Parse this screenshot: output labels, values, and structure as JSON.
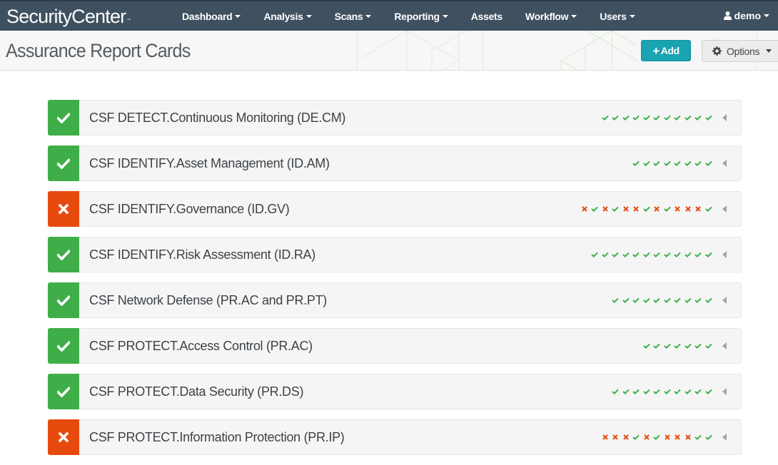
{
  "app": {
    "brand": "SecurityCenter",
    "brand_mark": "™"
  },
  "nav": {
    "items": [
      {
        "label": "Dashboard",
        "dropdown": true
      },
      {
        "label": "Analysis",
        "dropdown": true
      },
      {
        "label": "Scans",
        "dropdown": true
      },
      {
        "label": "Reporting",
        "dropdown": true
      },
      {
        "label": "Assets",
        "dropdown": false
      },
      {
        "label": "Workflow",
        "dropdown": true
      },
      {
        "label": "Users",
        "dropdown": true
      }
    ],
    "user": {
      "label": "demo",
      "icon": "user-icon"
    }
  },
  "page": {
    "title": "Assurance Report Cards",
    "add_button": {
      "label": "Add",
      "icon": "plus-icon"
    },
    "options_button": {
      "label": "Options",
      "icon": "gear-icon"
    }
  },
  "colors": {
    "nav_bg": "#3f5060",
    "pass": "#3fae49",
    "fail": "#e64a0c",
    "add_button": "#1aa3b0"
  },
  "cards": [
    {
      "title": "CSF DETECT.Continuous Monitoring (DE.CM)",
      "status": "pass",
      "history": [
        "pass",
        "pass",
        "pass",
        "pass",
        "pass",
        "pass",
        "pass",
        "pass",
        "pass",
        "pass",
        "pass"
      ]
    },
    {
      "title": "CSF IDENTIFY.Asset Management (ID.AM)",
      "status": "pass",
      "history": [
        "pass",
        "pass",
        "pass",
        "pass",
        "pass",
        "pass",
        "pass",
        "pass"
      ]
    },
    {
      "title": "CSF IDENTIFY.Governance (ID.GV)",
      "status": "fail",
      "history": [
        "fail",
        "pass",
        "fail",
        "pass",
        "fail",
        "fail",
        "pass",
        "fail",
        "pass",
        "fail",
        "fail",
        "fail",
        "pass"
      ]
    },
    {
      "title": "CSF IDENTIFY.Risk Assessment (ID.RA)",
      "status": "pass",
      "history": [
        "pass",
        "pass",
        "pass",
        "pass",
        "pass",
        "pass",
        "pass",
        "pass",
        "pass",
        "pass",
        "pass",
        "pass"
      ]
    },
    {
      "title": "CSF Network Defense (PR.AC and PR.PT)",
      "status": "pass",
      "history": [
        "pass",
        "pass",
        "pass",
        "pass",
        "pass",
        "pass",
        "pass",
        "pass",
        "pass",
        "pass"
      ]
    },
    {
      "title": "CSF PROTECT.Access Control (PR.AC)",
      "status": "pass",
      "history": [
        "pass",
        "pass",
        "pass",
        "pass",
        "pass",
        "pass",
        "pass"
      ]
    },
    {
      "title": "CSF PROTECT.Data Security (PR.DS)",
      "status": "pass",
      "history": [
        "pass",
        "pass",
        "pass",
        "pass",
        "pass",
        "pass",
        "pass",
        "pass",
        "pass",
        "pass"
      ]
    },
    {
      "title": "CSF PROTECT.Information Protection (PR.IP)",
      "status": "fail",
      "history": [
        "fail",
        "fail",
        "fail",
        "pass",
        "fail",
        "pass",
        "fail",
        "fail",
        "fail",
        "pass",
        "pass"
      ]
    }
  ]
}
